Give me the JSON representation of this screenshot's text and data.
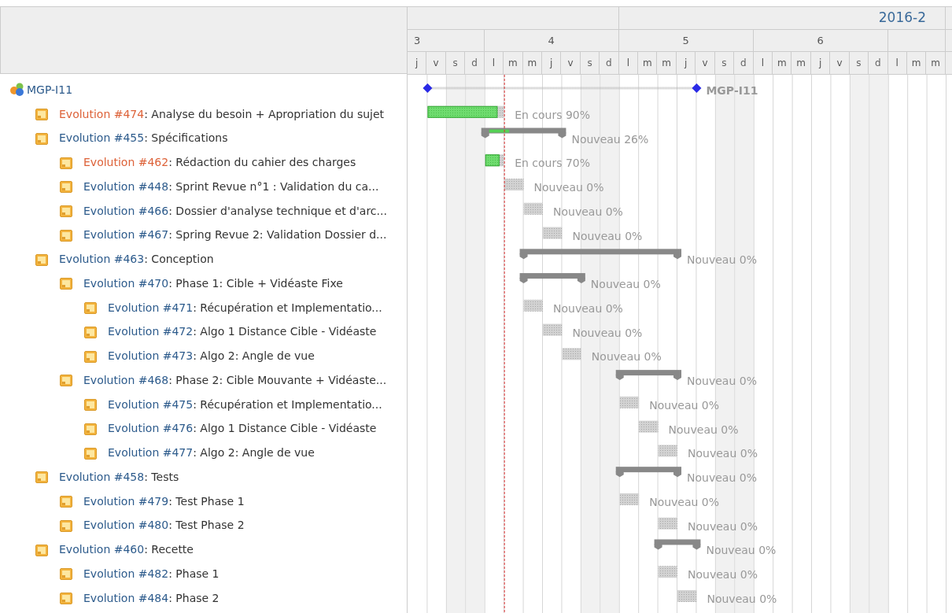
{
  "timeline": {
    "months": [
      {
        "weeks": [
          {
            "label": "3",
            "days": [
              {
                "label": "j",
                "weekend": false
              },
              {
                "label": "v",
                "weekend": false
              },
              {
                "label": "s",
                "weekend": true
              },
              {
                "label": "d",
                "weekend": true
              }
            ]
          },
          {
            "label": "4",
            "days": [
              {
                "label": "l",
                "weekend": false
              },
              {
                "label": "m",
                "weekend": false
              },
              {
                "label": "m",
                "weekend": false
              },
              {
                "label": "j",
                "weekend": false
              },
              {
                "label": "v",
                "weekend": false
              },
              {
                "label": "s",
                "weekend": true
              },
              {
                "label": "d",
                "weekend": true
              }
            ]
          }
        ]
      },
      {
        "label": "2016-2",
        "weeks": [
          {
            "label": "5",
            "days": [
              {
                "label": "l",
                "weekend": false
              },
              {
                "label": "m",
                "weekend": false
              },
              {
                "label": "m",
                "weekend": false
              },
              {
                "label": "j",
                "weekend": false
              },
              {
                "label": "v",
                "weekend": false
              },
              {
                "label": "s",
                "weekend": true
              },
              {
                "label": "d",
                "weekend": true
              }
            ]
          },
          {
            "label": "6",
            "days": [
              {
                "label": "l",
                "weekend": false
              },
              {
                "label": "m",
                "weekend": false
              },
              {
                "label": "m",
                "weekend": false
              },
              {
                "label": "j",
                "weekend": false
              },
              {
                "label": "v",
                "weekend": false
              },
              {
                "label": "s",
                "weekend": true
              },
              {
                "label": "d",
                "weekend": true
              }
            ]
          },
          {
            "days": [
              {
                "label": "l",
                "weekend": false
              },
              {
                "label": "m",
                "weekend": false
              },
              {
                "label": "m",
                "weekend": false
              }
            ]
          }
        ]
      }
    ]
  },
  "project": {
    "name": "MGP-I11",
    "kind": "project",
    "bar_label": "MGP-I11",
    "children": [
      {
        "kind": "task",
        "link": "Evolution #474",
        "subject": ": Analyse du besoin + Apropriation du sujet",
        "color": "#dd6239",
        "level": 0.9,
        "status": "En cours 90%"
      },
      {
        "kind": "parent",
        "link": "Evolution #455",
        "subject": ": Spécifications",
        "color": "#2d5b8c",
        "status": "Nouveau 26%",
        "children": [
          {
            "kind": "task",
            "link": "Evolution #462",
            "subject": ": Rédaction du cahier des charges",
            "color": "#dd6239",
            "status": "En cours 70%"
          },
          {
            "kind": "task",
            "link": "Evolution #448",
            "subject": ": Sprint Revue n°1 : Validation du ca...",
            "color": "#2d5b8c",
            "status": "Nouveau 0%"
          },
          {
            "kind": "task",
            "link": "Evolution #466",
            "subject": ": Dossier d'analyse technique et d'arc...",
            "color": "#2d5b8c",
            "status": "Nouveau 0%"
          },
          {
            "kind": "task",
            "link": "Evolution #467",
            "subject": ": Spring Revue 2: Validation Dossier d...",
            "color": "#2d5b8c",
            "status": "Nouveau 0%"
          }
        ]
      },
      {
        "kind": "parent",
        "link": "Evolution #463",
        "subject": ": Conception",
        "color": "#2d5b8c",
        "status": "Nouveau 0%",
        "children": [
          {
            "kind": "parent",
            "link": "Evolution #470",
            "subject": ": Phase 1: Cible + Vidéaste Fixe",
            "color": "#2d5b8c",
            "status": "Nouveau 0%",
            "children": [
              {
                "kind": "task",
                "link": "Evolution #471",
                "subject": ": Récupération et Implementatio...",
                "color": "#2d5b8c",
                "status": "Nouveau 0%"
              },
              {
                "kind": "task",
                "link": "Evolution #472",
                "subject": ": Algo 1 Distance Cible - Vidéaste",
                "color": "#2d5b8c",
                "status": "Nouveau 0%"
              },
              {
                "kind": "task",
                "link": "Evolution #473",
                "subject": ": Algo 2: Angle de vue",
                "color": "#2d5b8c",
                "status": "Nouveau 0%"
              }
            ]
          },
          {
            "kind": "parent",
            "link": "Evolution #468",
            "subject": ": Phase 2: Cible Mouvante + Vidéaste...",
            "color": "#2d5b8c",
            "status": "Nouveau 0%",
            "children": [
              {
                "kind": "task",
                "link": "Evolution #475",
                "subject": ": Récupération et Implementatio...",
                "color": "#2d5b8c",
                "status": "Nouveau 0%"
              },
              {
                "kind": "task",
                "link": "Evolution #476",
                "subject": ": Algo 1 Distance Cible - Vidéaste",
                "color": "#2d5b8c",
                "status": "Nouveau 0%"
              },
              {
                "kind": "task",
                "link": "Evolution #477",
                "subject": ": Algo 2: Angle de vue",
                "color": "#2d5b8c",
                "status": "Nouveau 0%"
              }
            ]
          }
        ]
      },
      {
        "kind": "parent",
        "link": "Evolution #458",
        "subject": ": Tests",
        "color": "#2d5b8c",
        "status": "Nouveau 0%",
        "children": [
          {
            "kind": "task",
            "link": "Evolution #479",
            "subject": ": Test Phase 1",
            "color": "#2d5b8c",
            "status": "Nouveau 0%"
          },
          {
            "kind": "task",
            "link": "Evolution #480",
            "subject": ": Test Phase 2",
            "color": "#2d5b8c",
            "status": "Nouveau 0%"
          }
        ]
      },
      {
        "kind": "parent",
        "link": "Evolution #460",
        "subject": ": Recette",
        "color": "#2d5b8c",
        "status": "Nouveau 0%",
        "children": [
          {
            "kind": "task",
            "link": "Evolution #482",
            "subject": ": Phase 1",
            "color": "#2d5b8c",
            "status": "Nouveau 0%"
          },
          {
            "kind": "task",
            "link": "Evolution #484",
            "subject": ": Phase 2",
            "color": "#2d5b8c",
            "status": "Nouveau 0%"
          }
        ]
      }
    ]
  }
}
